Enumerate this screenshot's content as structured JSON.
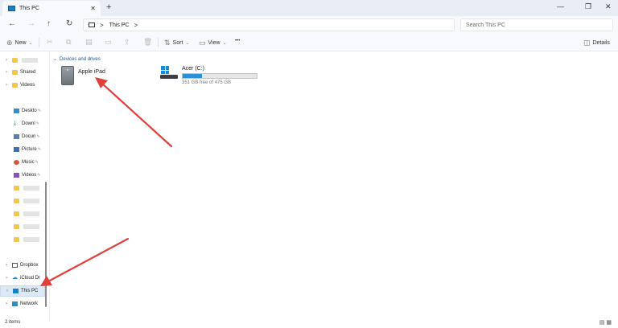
{
  "window": {
    "tab_title": "This PC",
    "new_tab": "+",
    "minimize": "—",
    "maximize": "❐",
    "close": "✕"
  },
  "nav": {
    "back": "←",
    "forward": "→",
    "up": "↑",
    "refresh": "↻",
    "breadcrumb": [
      "This PC"
    ],
    "search_placeholder": "Search This PC"
  },
  "toolbar": {
    "new_label": "New",
    "sort_label": "Sort",
    "view_label": "View",
    "more_label": "•••",
    "details_label": "Details"
  },
  "sidebar": {
    "pinned": [
      {
        "label": "Deskto",
        "icon": "desktop-icon"
      },
      {
        "label": "Downl",
        "icon": "download-icon"
      },
      {
        "label": "Docun",
        "icon": "document-icon"
      },
      {
        "label": "Picture",
        "icon": "pictures-icon"
      },
      {
        "label": "Music",
        "icon": "music-icon"
      },
      {
        "label": "Videos",
        "icon": "videos-icon"
      }
    ],
    "top_items": [
      {
        "label": "",
        "icon": "folder-icon"
      },
      {
        "label": "Shared",
        "icon": "folder-icon"
      },
      {
        "label": "Videos",
        "icon": "folder-icon"
      }
    ],
    "bottom_items": [
      {
        "label": "Dropbox",
        "icon": "dropbox-icon"
      },
      {
        "label": "iCloud Dr",
        "icon": "icloud-icon"
      },
      {
        "label": "This PC",
        "icon": "this-pc-icon",
        "selected": true
      },
      {
        "label": "Network",
        "icon": "network-icon"
      }
    ]
  },
  "content": {
    "group_title": "Devices and drives",
    "devices": [
      {
        "name": "Apple iPad",
        "icon": "ipad-icon"
      },
      {
        "name": "Acer (C:)",
        "icon": "drive-icon",
        "free_text": "351 GB free of 475 GB",
        "used_fraction": 0.26
      }
    ]
  },
  "status": {
    "item_count": "2 items"
  },
  "colors": {
    "accent": "#2a8fd6",
    "arrow": "#e0403a",
    "selected_bg": "#dce8f6"
  }
}
